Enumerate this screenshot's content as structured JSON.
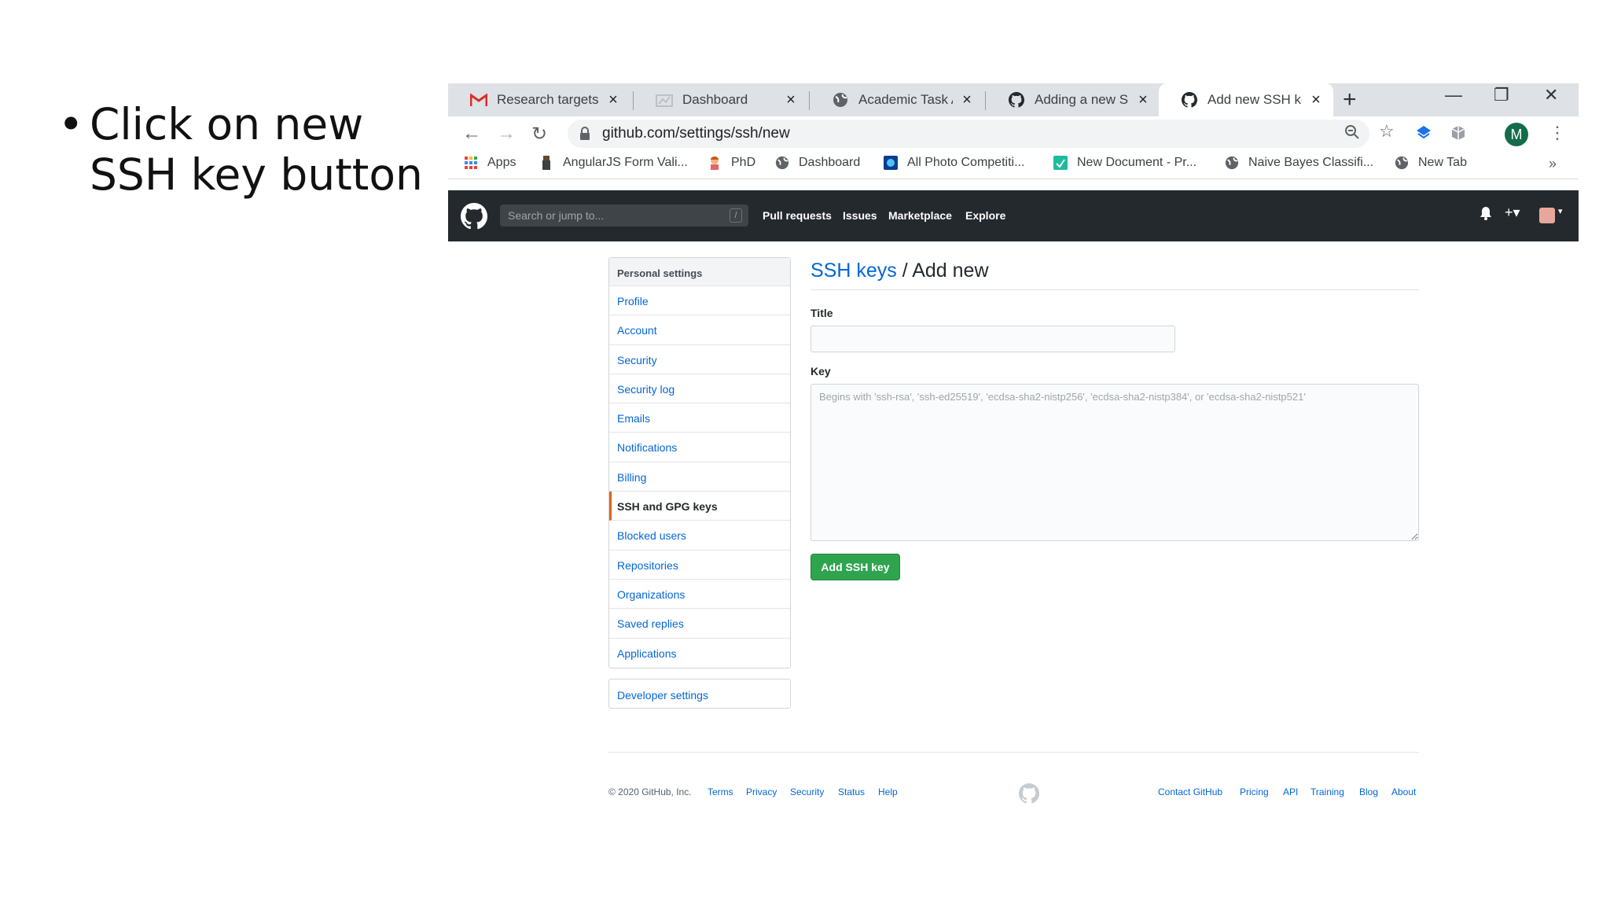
{
  "slide": {
    "bullet": "•",
    "text": "Click on new SSH key button"
  },
  "browser": {
    "tabs": [
      {
        "title": "Research targets f",
        "icon": "gmail-icon",
        "close": "×",
        "active": false
      },
      {
        "title": "Dashboard",
        "icon": "dashboard-icon",
        "close": "×",
        "active": false
      },
      {
        "title": "Academic Task All",
        "icon": "globe-icon",
        "close": "×",
        "active": false
      },
      {
        "title": "Adding a new SSH",
        "icon": "github-icon",
        "close": "×",
        "active": false
      },
      {
        "title": "Add new SSH key",
        "icon": "github-icon",
        "close": "×",
        "active": true
      }
    ],
    "new_tab": "+",
    "window_controls": {
      "minimize": "—",
      "restore": "❐",
      "close": "✕"
    },
    "nav": {
      "back": "←",
      "forward": "→",
      "reload": "↻"
    },
    "url": "github.com/settings/ssh/new",
    "profile_initial": "M",
    "bookmarks": [
      {
        "label": "Apps",
        "icon": "apps-grid-icon"
      },
      {
        "label": "AngularJS Form Vali...",
        "icon": "angular-icon"
      },
      {
        "label": "PhD",
        "icon": "person-icon"
      },
      {
        "label": "Dashboard",
        "icon": "globe-icon"
      },
      {
        "label": "All Photo Competiti...",
        "icon": "photo-icon"
      },
      {
        "label": "New Document - Pr...",
        "icon": "doc-icon"
      },
      {
        "label": "Naive Bayes Classifi...",
        "icon": "globe-icon"
      },
      {
        "label": "New Tab",
        "icon": "globe-icon"
      }
    ],
    "bookmarks_more": "»"
  },
  "github": {
    "search_placeholder": "Search or jump to...",
    "search_key": "/",
    "nav": [
      "Pull requests",
      "Issues",
      "Marketplace",
      "Explore"
    ],
    "sidebar_header": "Personal settings",
    "sidebar_items": [
      "Profile",
      "Account",
      "Security",
      "Security log",
      "Emails",
      "Notifications",
      "Billing",
      "SSH and GPG keys",
      "Blocked users",
      "Repositories",
      "Organizations",
      "Saved replies",
      "Applications"
    ],
    "selected_item": "SSH and GPG keys",
    "developer_settings": "Developer settings",
    "breadcrumb_link": "SSH keys",
    "breadcrumb_rest": " / Add new",
    "title_label": "Title",
    "title_value": "",
    "key_label": "Key",
    "key_placeholder": "Begins with 'ssh-rsa', 'ssh-ed25519', 'ecdsa-sha2-nistp256', 'ecdsa-sha2-nistp384', or 'ecdsa-sha2-nistp521'",
    "add_button": "Add SSH key",
    "footer_copyright": "© 2020 GitHub, Inc.",
    "footer_left": [
      "Terms",
      "Privacy",
      "Security",
      "Status",
      "Help"
    ],
    "footer_right": [
      "Contact GitHub",
      "Pricing",
      "API",
      "Training",
      "Blog",
      "About"
    ]
  },
  "colors": {
    "accent_green": "#2ea44f",
    "link_blue": "#0366d6",
    "header_dark": "#24292e",
    "selected_marker": "#e36209"
  }
}
